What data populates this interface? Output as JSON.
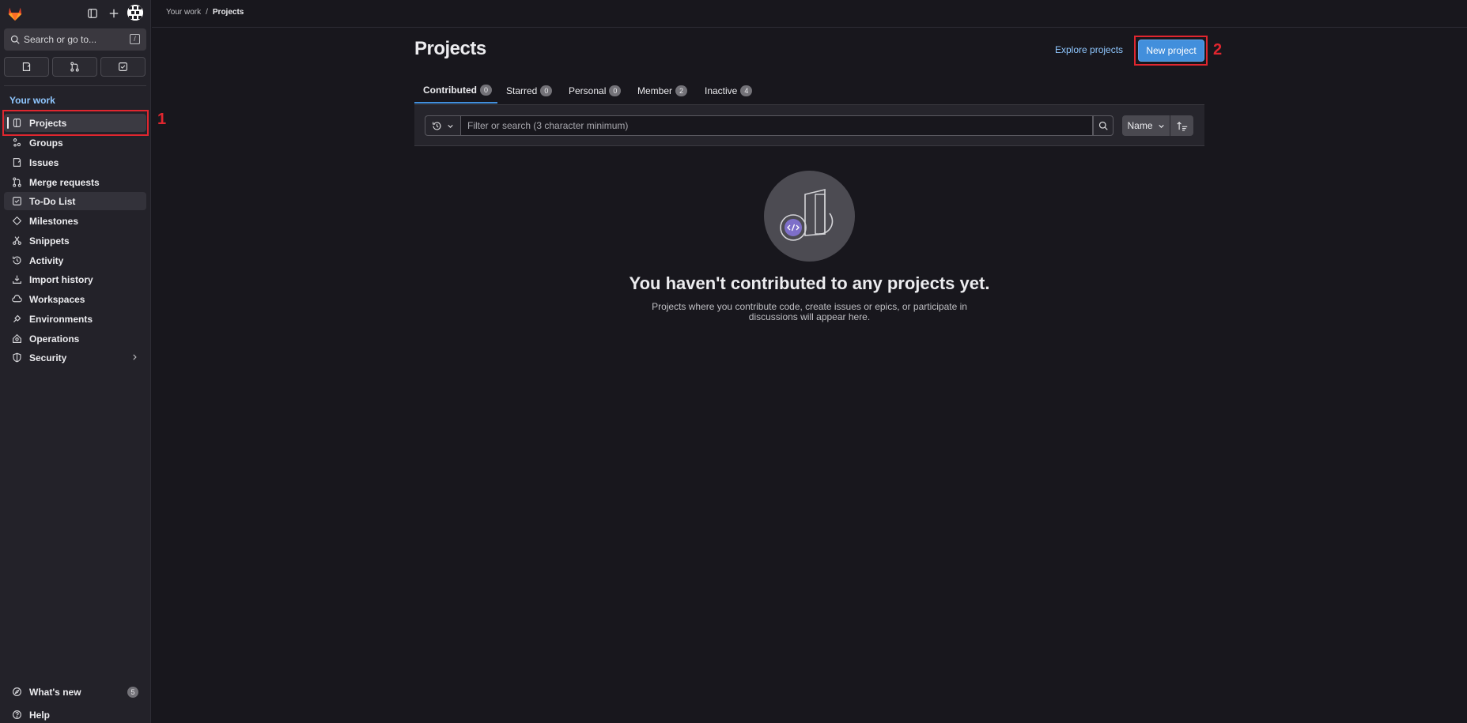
{
  "header": {
    "breadcrumb": [
      "Your work",
      "Projects"
    ],
    "separator": "/"
  },
  "sidebar": {
    "search_placeholder": "Search or go to...",
    "search_shortcut": "/",
    "section_title": "Your work",
    "items": [
      {
        "label": "Projects",
        "icon": "project-icon"
      },
      {
        "label": "Groups",
        "icon": "group-icon"
      },
      {
        "label": "Issues",
        "icon": "issues-icon"
      },
      {
        "label": "Merge requests",
        "icon": "merge-request-icon"
      },
      {
        "label": "To-Do List",
        "icon": "todo-icon"
      },
      {
        "label": "Milestones",
        "icon": "milestone-icon"
      },
      {
        "label": "Snippets",
        "icon": "snippet-icon"
      },
      {
        "label": "Activity",
        "icon": "history-icon"
      },
      {
        "label": "Import history",
        "icon": "import-icon"
      },
      {
        "label": "Workspaces",
        "icon": "workspace-icon"
      },
      {
        "label": "Environments",
        "icon": "environment-icon"
      },
      {
        "label": "Operations",
        "icon": "operations-icon"
      },
      {
        "label": "Security",
        "icon": "shield-icon"
      }
    ],
    "whats_new": {
      "label": "What's new",
      "count": "5"
    },
    "help": {
      "label": "Help"
    }
  },
  "main": {
    "title": "Projects",
    "explore_label": "Explore projects",
    "new_project_label": "New project",
    "tabs": [
      {
        "label": "Contributed",
        "count": "0"
      },
      {
        "label": "Starred",
        "count": "0"
      },
      {
        "label": "Personal",
        "count": "0"
      },
      {
        "label": "Member",
        "count": "2"
      },
      {
        "label": "Inactive",
        "count": "4"
      }
    ],
    "filter_placeholder": "Filter or search (3 character minimum)",
    "sort_label": "Name",
    "empty_title": "You haven't contributed to any projects yet.",
    "empty_desc": "Projects where you contribute code, create issues or epics, or participate in discussions will appear here."
  },
  "annotations": [
    "1",
    "2"
  ],
  "colors": {
    "accent": "#428fdc",
    "annotation": "#e0262f",
    "link": "#8fc7ff"
  }
}
